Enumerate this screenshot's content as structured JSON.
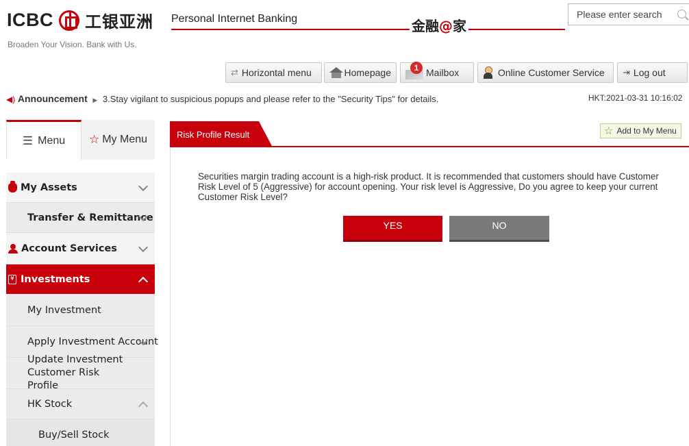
{
  "header": {
    "logo_text": "ICBC",
    "logo_cn": "工银亚洲",
    "slogan": "Broaden Your Vision. Bank with Us.",
    "service_title": "Personal Internet Banking",
    "brand_cn_prefix": "金融",
    "brand_cn_at": "@",
    "brand_cn_suffix": "家",
    "search_placeholder": "Please enter search"
  },
  "toolbar": {
    "horizontal_menu": "Horizontal menu",
    "homepage": "Homepage",
    "mailbox": "Mailbox",
    "mailbox_count": "1",
    "online_service": "Online Customer Service",
    "logout": "Log out"
  },
  "announcement": {
    "label": "Announcement",
    "text": "3.Stay vigilant to suspicious popups and please refer to the \"Security Tips\" for details.",
    "time": "HKT:2021-03-31 10:16:02"
  },
  "sidebar": {
    "tabs": {
      "menu": "Menu",
      "my_menu": "My Menu"
    },
    "items": {
      "my_assets": "My Assets",
      "transfer": "Transfer & Remittance",
      "account_services": "Account Services",
      "investments": "Investments",
      "my_investment": "My Investment",
      "apply_account": "Apply Investment Account",
      "update_profile": "Update Investment Customer Risk Profile",
      "hk_stock": "HK Stock",
      "buy_sell": "Buy/Sell Stock"
    }
  },
  "main": {
    "tab_title": "Risk Profile Result",
    "add_to_menu": "Add to My Menu",
    "message": "Securities margin trading account is a high-risk product. It is recommended that customers should have Customer Risk Level of 5 (Aggressive) for account opening. Your risk level is Aggressive, Do you agree to keep your current Customer Risk Level?",
    "yes": "YES",
    "no": "NO"
  },
  "colors": {
    "brand_red": "#c7000b",
    "sidebar_bg": "#f4f4f4",
    "no_button": "#7a7a7a"
  }
}
